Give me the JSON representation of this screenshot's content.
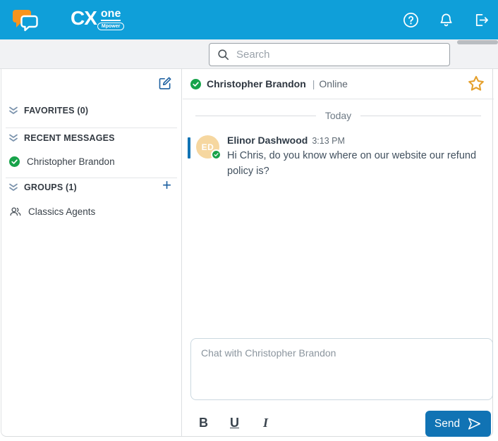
{
  "header": {
    "logo": {
      "cx": "CX",
      "one": "one",
      "badge": "Mpower"
    },
    "icons": {
      "help": "help-icon",
      "notifications": "bell-icon",
      "logout": "logout-icon",
      "app": "chat-bubbles-logo"
    }
  },
  "search": {
    "placeholder": "Search"
  },
  "sidebar": {
    "compose_icon": "compose-icon",
    "favorites": {
      "label": "FAVORITES (0)"
    },
    "recent": {
      "label": "RECENT MESSAGES",
      "contact": {
        "name": "Christopher Brandon",
        "status": "online"
      }
    },
    "groups": {
      "label": "GROUPS (1)",
      "add_button": "+",
      "group": {
        "name": "Classics Agents",
        "icon": "people-icon"
      }
    }
  },
  "chat": {
    "header": {
      "name": "Christopher Brandon",
      "separator": "|",
      "status": "Online",
      "favorite_icon": "star-icon"
    },
    "date_divider": "Today",
    "messages": [
      {
        "initials": "ED",
        "sender": "Elinor Dashwood",
        "time": "3:13 PM",
        "text": "Hi Chris, do you know where on our website our refund policy is?",
        "status": "online"
      }
    ],
    "composer": {
      "placeholder": "Chat with Christopher Brandon"
    },
    "toolbar": {
      "bold": "B",
      "underline": "U",
      "italic": "I"
    },
    "send_label": "Send"
  },
  "colors": {
    "header_blue": "#0f9fd9",
    "accent_blue": "#1173b4",
    "link_blue": "#1b5fa0",
    "status_green": "#17a34a",
    "avatar_tan": "#f6d7a0",
    "star_amber": "#e5a02c",
    "logo_orange": "#f7941d"
  }
}
